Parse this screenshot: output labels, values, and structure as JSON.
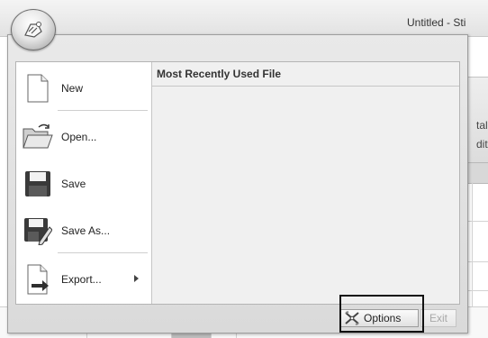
{
  "window": {
    "title": "Untitled - Sti"
  },
  "ribbon": {
    "fragment_1": "tal",
    "fragment_2": "dit"
  },
  "app_menu": {
    "commands": [
      {
        "label": "New",
        "icon": "new-document-icon"
      },
      {
        "label": "Open...",
        "icon": "open-folder-icon"
      },
      {
        "label": "Save",
        "icon": "save-floppy-icon"
      },
      {
        "label": "Save As...",
        "icon": "save-as-icon"
      },
      {
        "label": "Export...",
        "icon": "export-icon",
        "has_submenu": true
      }
    ],
    "mru_heading": "Most Recently Used File",
    "options_label": "Options",
    "exit_label": "Exit"
  },
  "colors": {
    "menu_bg": "#dadada",
    "highlight_border": "#111111"
  }
}
